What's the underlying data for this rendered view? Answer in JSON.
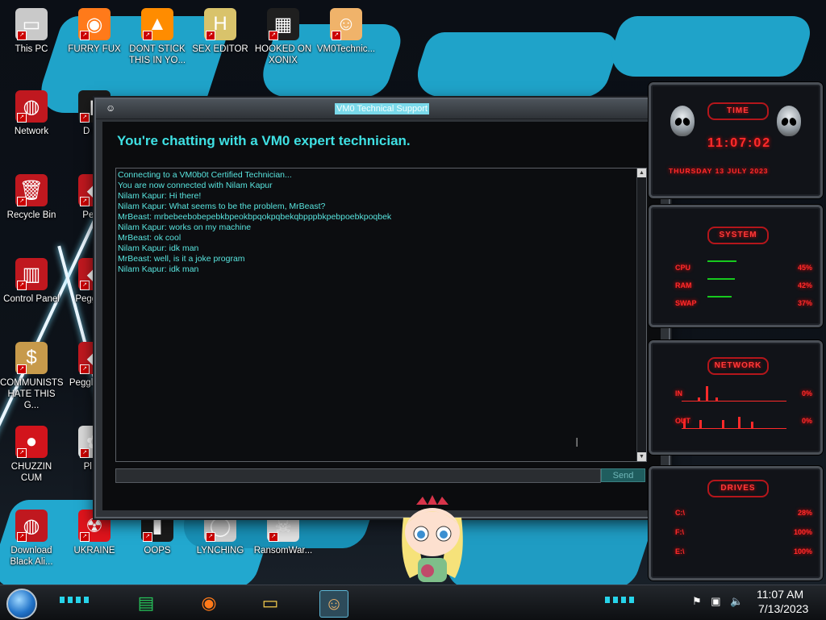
{
  "desktop_icons": [
    {
      "label": "This PC",
      "icon": "computer-icon",
      "color": "#c9c9c9"
    },
    {
      "label": "FURRY FUX",
      "icon": "firefox-icon",
      "color": "#ff7a1a"
    },
    {
      "label": "DONT STICK THIS IN YO...",
      "icon": "traffic-cone-icon",
      "color": "#ff8c00"
    },
    {
      "label": "SEX EDITOR",
      "icon": "hxd-editor-icon",
      "color": "#d9c36b"
    },
    {
      "label": "HOOKED ON XONIX",
      "icon": "xonix-game-icon",
      "color": "#1f1f1f"
    },
    {
      "label": "VM0Technic...",
      "icon": "technician-icon",
      "color": "#f0b36a"
    },
    {
      "label": "Network",
      "icon": "network-globe-icon",
      "color": "#c0181f"
    },
    {
      "label": "Recycle Bin",
      "icon": "recycle-bin-icon",
      "color": "#c0181f"
    },
    {
      "label": "Control Panel",
      "icon": "control-panel-icon",
      "color": "#c0181f"
    },
    {
      "label": "COMMUNISTS HATE THIS G...",
      "icon": "money-bag-icon",
      "color": "#c79a4b"
    },
    {
      "label": "CHUZZIN CUM",
      "icon": "chuzzle-icon",
      "color": "#d2141c"
    },
    {
      "label": "Download Black Ali...",
      "icon": "download-globe-icon",
      "color": "#c0181f"
    },
    {
      "label": "UKRAINE",
      "icon": "radiation-icon",
      "color": "#e0141c"
    },
    {
      "label": "OOPS",
      "icon": "oops-icon",
      "color": "#1b1b1b"
    },
    {
      "label": "LYNCHING",
      "icon": "rope-icon",
      "color": "#cfcfcf"
    },
    {
      "label": "RansomWar...",
      "icon": "skull-icon",
      "color": "#e0e0e0"
    },
    {
      "label": "D DU",
      "icon": "partial-icon",
      "color": "#1b1b1b"
    },
    {
      "label": "Peggl",
      "icon": "peggle-icon",
      "color": "#c0181f"
    },
    {
      "label": "Peggl De",
      "icon": "peggle-icon",
      "color": "#c0181f"
    },
    {
      "label": "Peggl of Wa",
      "icon": "peggle-icon",
      "color": "#c0181f"
    },
    {
      "label": "Pl Zo",
      "icon": "plants-icon",
      "color": "#d9d9d9"
    }
  ],
  "chat_window": {
    "title": "VM0 Technical Support",
    "heading": "You're chatting with a VM0 expert technician.",
    "messages": [
      "Connecting to a VM0b0t Certified Technician...",
      "You are now connected with Nilam Kapur",
      "Nilam Kapur: Hi there!",
      "Nilam Kapur: What seems to be the problem, MrBeast?",
      "MrBeast: mrbebeebobepebkbpeokbpqokpqbekqbpppbkpebpoebkpoqbek",
      "Nilam Kapur: works on my machine",
      "MrBeast: ok cool",
      "Nilam Kapur: idk man",
      "MrBeast: well, is it a joke program",
      "Nilam Kapur: idk man"
    ],
    "input_value": "",
    "send_label": "Send",
    "accent": "#3fe0e3"
  },
  "gadgets": {
    "time": {
      "title": "TIME",
      "clock": "11:07:02",
      "date": "THURSDAY 13 JULY 2023"
    },
    "system": {
      "title": "SYSTEM",
      "rows": [
        {
          "label": "CPU",
          "value": "45%",
          "percent": 45
        },
        {
          "label": "RAM",
          "value": "42%",
          "percent": 42
        },
        {
          "label": "SWAP",
          "value": "37%",
          "percent": 37
        }
      ]
    },
    "network": {
      "title": "NETWORK",
      "rows": [
        {
          "label": "IN",
          "value": "0%"
        },
        {
          "label": "OUT",
          "value": "0%"
        }
      ]
    },
    "drives": {
      "title": "DRIVES",
      "rows": [
        {
          "label": "C:\\",
          "value": "28%",
          "percent": 28
        },
        {
          "label": "F:\\",
          "value": "100%",
          "percent": 100
        },
        {
          "label": "E:\\",
          "value": "100%",
          "percent": 100
        }
      ]
    },
    "accent": "#ff2b2b"
  },
  "taskbar": {
    "apps": [
      {
        "name": "notes-app-icon",
        "glyph": "▤",
        "color": "#27c35a"
      },
      {
        "name": "firefox-icon",
        "glyph": "◉",
        "color": "#ff7a1a"
      },
      {
        "name": "file-explorer-icon",
        "glyph": "▭",
        "color": "#f2c94c"
      },
      {
        "name": "vm0-technician-icon",
        "glyph": "☺",
        "color": "#f0b36a"
      }
    ],
    "clock_time": "11:07 AM",
    "clock_date": "7/13/2023"
  }
}
